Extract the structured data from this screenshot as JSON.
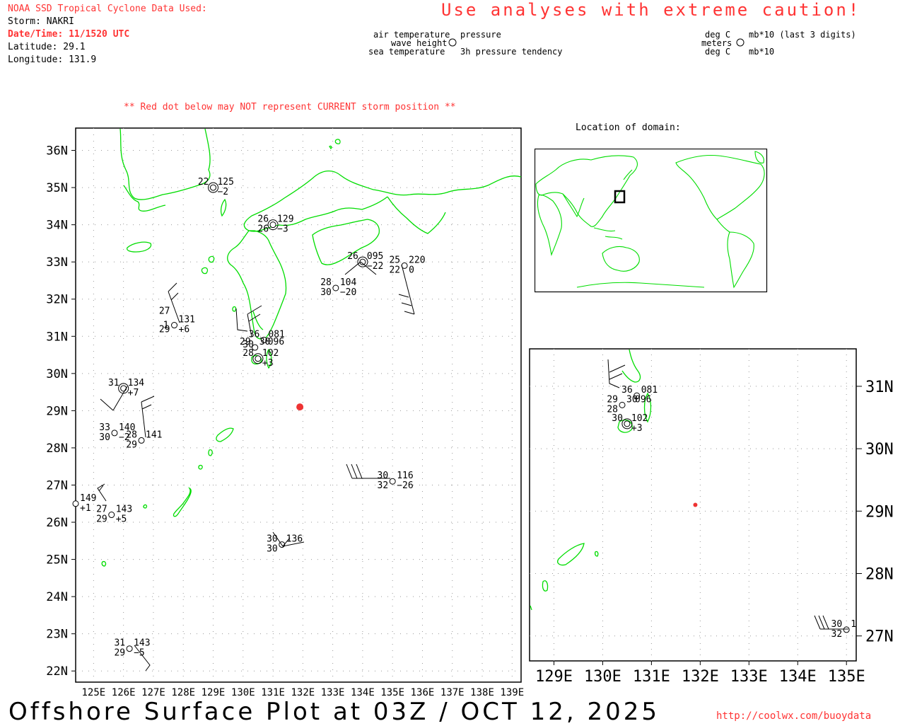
{
  "header": {
    "source": "NOAA SSD Tropical Cyclone Data Used:",
    "storm": "Storm: NAKRI",
    "datetime": "Date/Time: 11/1520 UTC",
    "latitude": "Latitude: 29.1",
    "longitude": "Longitude: 131.9",
    "caution": "Use analyses with extreme caution!"
  },
  "legend": {
    "left": {
      "top_left": "air temperature",
      "top_right": "pressure",
      "mid_left": "wave height",
      "bottom_left": "sea temperature",
      "bottom_right": "3h pressure tendency"
    },
    "right": {
      "top_left": "deg C",
      "top_right": "mb*10 (last 3 digits)",
      "mid_left": "meters",
      "bottom_left": "deg C",
      "bottom_right": "mb*10"
    }
  },
  "warning": "** Red dot below may NOT represent CURRENT storm position **",
  "inset_title": "Location of domain:",
  "footer": {
    "title": "Offshore Surface Plot at 03Z / OCT 12, 2025",
    "url": "http://coolwx.com/buoydata"
  },
  "colors": {
    "land": "#00dd00",
    "text_red": "#ff3333",
    "storm": "#ee3333",
    "grid": "#999999"
  },
  "main_map": {
    "lat_labels": [
      "22N",
      "23N",
      "24N",
      "25N",
      "26N",
      "27N",
      "28N",
      "29N",
      "30N",
      "31N",
      "32N",
      "33N",
      "34N",
      "35N",
      "36N"
    ],
    "lon_labels": [
      "125E",
      "126E",
      "127E",
      "128E",
      "129E",
      "130E",
      "131E",
      "132E",
      "133E",
      "134E",
      "135E",
      "136E",
      "137E",
      "138E",
      "139E"
    ],
    "storm": {
      "lat": 29.1,
      "lon": 131.9
    },
    "stations": [
      {
        "lat": 35.0,
        "lon": 129.0,
        "ring": true,
        "labels": [
          {
            "t": "22",
            "p": "ul"
          },
          {
            "t": "125",
            "p": "ur"
          },
          {
            "t": "−2",
            "p": "lr"
          }
        ]
      },
      {
        "lat": 34.0,
        "lon": 131.0,
        "ring": true,
        "labels": [
          {
            "t": "26",
            "p": "ul"
          },
          {
            "t": "129",
            "p": "ur"
          },
          {
            "t": "26",
            "p": "ll"
          },
          {
            "t": "−3",
            "p": "lr"
          }
        ]
      },
      {
        "lat": 33.0,
        "lon": 134.0,
        "ring": true,
        "labels": [
          {
            "t": "26",
            "p": "ul"
          },
          {
            "t": "095",
            "p": "ur"
          },
          {
            "t": "−22",
            "p": "lr"
          }
        ]
      },
      {
        "lat": 32.9,
        "lon": 135.4,
        "ring": false,
        "labels": [
          {
            "t": "25",
            "p": "ul"
          },
          {
            "t": "220",
            "p": "ur"
          },
          {
            "t": "22",
            "p": "ll"
          },
          {
            "t": "0",
            "p": "lr"
          }
        ]
      },
      {
        "lat": 32.3,
        "lon": 133.1,
        "ring": false,
        "labels": [
          {
            "t": "28",
            "p": "ul"
          },
          {
            "t": "104",
            "p": "ur"
          },
          {
            "t": "30",
            "p": "ll"
          },
          {
            "t": "−20",
            "p": "lr"
          }
        ]
      },
      {
        "lat": 31.3,
        "lon": 127.7,
        "ring": false,
        "labels": [
          {
            "t": "27",
            "p": "ul2"
          },
          {
            "t": "131",
            "p": "ur"
          },
          {
            "t": "1",
            "p": "ml"
          },
          {
            "t": "29",
            "p": "ll"
          },
          {
            "t": "+6",
            "p": "lr"
          }
        ]
      },
      {
        "lat": 30.9,
        "lon": 130.7,
        "ring": false,
        "labels": [
          {
            "t": "36",
            "p": "ul"
          },
          {
            "t": "081",
            "p": "ur"
          }
        ]
      },
      {
        "lat": 30.7,
        "lon": 130.4,
        "ring": false,
        "labels": [
          {
            "t": "29",
            "p": "ul"
          },
          {
            "t": "30",
            "p": "ur"
          },
          {
            "t": "096",
            "p": "ur2"
          }
        ]
      },
      {
        "lat": 30.4,
        "lon": 130.5,
        "ring": true,
        "labels": [
          {
            "t": "28",
            "p": "ul"
          },
          {
            "t": "30",
            "p": "ul2"
          },
          {
            "t": "102",
            "p": "ur"
          },
          {
            "t": "+3",
            "p": "lr"
          }
        ]
      },
      {
        "lat": 29.6,
        "lon": 126.0,
        "ring": true,
        "labels": [
          {
            "t": "31",
            "p": "ul"
          },
          {
            "t": "134",
            "p": "ur"
          },
          {
            "t": "+7",
            "p": "lr"
          }
        ]
      },
      {
        "lat": 28.4,
        "lon": 125.7,
        "ring": false,
        "labels": [
          {
            "t": "33",
            "p": "ul"
          },
          {
            "t": "140",
            "p": "ur"
          },
          {
            "t": "30",
            "p": "ll"
          },
          {
            "t": "−2",
            "p": "lr"
          }
        ]
      },
      {
        "lat": 28.2,
        "lon": 126.6,
        "ring": false,
        "labels": [
          {
            "t": "28",
            "p": "ul"
          },
          {
            "t": "141",
            "p": "ur"
          },
          {
            "t": "29",
            "p": "ll"
          }
        ]
      },
      {
        "lat": 27.1,
        "lon": 135.0,
        "ring": false,
        "labels": [
          {
            "t": "30",
            "p": "ul"
          },
          {
            "t": "116",
            "p": "ur"
          },
          {
            "t": "32",
            "p": "ll"
          },
          {
            "t": "−26",
            "p": "lr"
          }
        ]
      },
      {
        "lat": 26.5,
        "lon": 124.4,
        "ring": false,
        "labels": [
          {
            "t": "149",
            "p": "ur"
          },
          {
            "t": "+1",
            "p": "lr"
          }
        ]
      },
      {
        "lat": 26.2,
        "lon": 125.6,
        "ring": false,
        "labels": [
          {
            "t": "27",
            "p": "ul"
          },
          {
            "t": "143",
            "p": "ur"
          },
          {
            "t": "29",
            "p": "ll"
          },
          {
            "t": "+5",
            "p": "lr"
          }
        ]
      },
      {
        "lat": 25.4,
        "lon": 131.3,
        "ring": false,
        "labels": [
          {
            "t": "30",
            "p": "ul"
          },
          {
            "t": "136",
            "p": "ur"
          },
          {
            "t": "30",
            "p": "ll"
          }
        ]
      },
      {
        "lat": 22.6,
        "lon": 126.2,
        "ring": false,
        "labels": [
          {
            "t": "31",
            "p": "ul"
          },
          {
            "t": "143",
            "p": "ur"
          },
          {
            "t": "29",
            "p": "ll"
          },
          {
            "t": "−5",
            "p": "lr"
          }
        ]
      }
    ]
  },
  "zoom_map": {
    "lat_labels": [
      "27N",
      "28N",
      "29N",
      "30N",
      "31N"
    ],
    "lon_labels": [
      "129E",
      "130E",
      "131E",
      "132E",
      "133E",
      "134E",
      "135E"
    ],
    "stations": [
      {
        "lat": 30.85,
        "lon": 130.7,
        "ring": false,
        "labels": [
          {
            "t": "36",
            "p": "ul"
          },
          {
            "t": "081",
            "p": "ur"
          }
        ]
      },
      {
        "lat": 30.7,
        "lon": 130.4,
        "ring": false,
        "labels": [
          {
            "t": "29",
            "p": "ul"
          },
          {
            "t": "30",
            "p": "ur"
          },
          {
            "t": "096",
            "p": "ur2"
          },
          {
            "t": "28",
            "p": "ll"
          }
        ]
      },
      {
        "lat": 30.4,
        "lon": 130.5,
        "ring": true,
        "labels": [
          {
            "t": "30",
            "p": "ul"
          },
          {
            "t": "102",
            "p": "ur"
          },
          {
            "t": "+3",
            "p": "lr"
          }
        ]
      },
      {
        "lat": 27.1,
        "lon": 135.0,
        "ring": false,
        "labels": [
          {
            "t": "30",
            "p": "ul"
          },
          {
            "t": "1",
            "p": "ur"
          },
          {
            "t": "32",
            "p": "ll"
          }
        ]
      }
    ]
  }
}
